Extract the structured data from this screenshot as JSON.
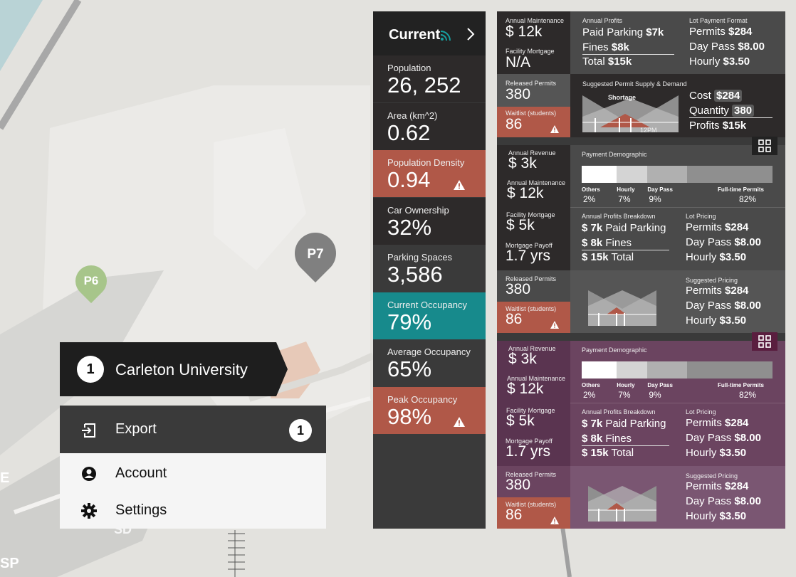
{
  "map": {
    "pins": [
      {
        "label": "P6",
        "color": "#a7c58a"
      },
      {
        "label": "P7",
        "color": "#808080"
      }
    ],
    "street_letters": [
      "E",
      "SP",
      "SD"
    ]
  },
  "campus": {
    "number": "1",
    "name": "Carleton University"
  },
  "menu": {
    "export": {
      "label": "Export",
      "badge": "1",
      "icon": "export-icon"
    },
    "account": {
      "label": "Account",
      "icon": "account-icon"
    },
    "settings": {
      "label": "Settings",
      "icon": "gear-icon"
    }
  },
  "current": {
    "title": "Current",
    "icons": [
      "rss-icon",
      "chevron-right-icon"
    ],
    "stats": [
      {
        "label": "Population",
        "value": "26, 252",
        "color": "#2d2a2a",
        "warn": false
      },
      {
        "label": "Area (km^2)",
        "value": "0.62",
        "color": "#2d2a2a",
        "warn": false
      },
      {
        "label": "Population Density",
        "value": "0.94",
        "color": "#b05848",
        "warn": true
      },
      {
        "label": "Car Ownership",
        "value": "32%",
        "color": "#2d2a2a",
        "warn": false
      },
      {
        "label": "Parking Spaces",
        "value": "3,586",
        "color": "#3a3a3a",
        "warn": false
      },
      {
        "label": "Current Occupancy",
        "value": "79%",
        "color": "#178a8c",
        "warn": false
      },
      {
        "label": "Average Occupancy",
        "value": "65%",
        "color": "#3a3a3a",
        "warn": false
      },
      {
        "label": "Peak Occupancy",
        "value": "98%",
        "color": "#b05848",
        "warn": true
      }
    ]
  },
  "block1": {
    "annual_maintenance_label": "Annual Maintenance",
    "annual_maintenance": "$ 12k",
    "facility_mortgage_label": "Facility Mortgage",
    "facility_mortgage": "N/A",
    "released_permits_label": "Released Permits",
    "released_permits": "380",
    "waitlist_label": "Waitlist (students)",
    "waitlist": "86",
    "profits_label": "Annual Profits",
    "profits": [
      {
        "name": "Paid Parking",
        "value": "$7k"
      },
      {
        "name": "Fines",
        "value": "$8k"
      },
      {
        "name": "Total",
        "value": "$15k"
      }
    ],
    "format_label": "Lot Payment Format",
    "format": [
      {
        "name": "Permits",
        "value": "$284"
      },
      {
        "name": "Day Pass",
        "value": "$8.00"
      },
      {
        "name": "Hourly",
        "value": "$3.50"
      }
    ],
    "supply_label": "Suggested Permit Supply & Demand",
    "shortage_label": "Shortage",
    "time_label": "12PM",
    "suggest": [
      {
        "name": "Cost",
        "value": "$284"
      },
      {
        "name": "Quantity",
        "value": "380"
      },
      {
        "name": "Profits",
        "value": "$15k"
      }
    ]
  },
  "blocks": [
    {
      "theme": "grey",
      "annual_revenue_label": "Annual Revenue",
      "annual_revenue": "$ 3k",
      "annual_maintenance_label": "Annual Maintenance",
      "annual_maintenance": "$ 12k",
      "facility_mortgage_label": "Facility Mortgage",
      "facility_mortgage": "$ 5k",
      "payoff_label": "Mortgage Payoff",
      "payoff": "1.7 yrs",
      "released_permits_label": "Released Permits",
      "released_permits": "380",
      "waitlist_label": "Waitlist (students)",
      "waitlist": "86",
      "demo_label": "Payment Demographic",
      "demo": [
        {
          "name": "Others",
          "pct": "2%",
          "share": 2
        },
        {
          "name": "Hourly",
          "pct": "7%",
          "share": 7
        },
        {
          "name": "Day Pass",
          "pct": "9%",
          "share": 9
        },
        {
          "name": "Full-time Permits",
          "pct": "82%",
          "share": 82
        }
      ],
      "breakdown_label": "Annual Profits Breakdown",
      "breakdown": [
        {
          "value": "$ 7k",
          "name": "Paid Parking"
        },
        {
          "value": "$ 8k",
          "name": "Fines"
        },
        {
          "value": "$ 15k",
          "name": "Total"
        }
      ],
      "pricing_label": "Lot Pricing",
      "pricing": [
        {
          "name": "Permits",
          "value": "$284"
        },
        {
          "name": "Day Pass",
          "value": "$8.00"
        },
        {
          "name": "Hourly",
          "value": "$3.50"
        }
      ],
      "suggested_label": "Suggested Pricing",
      "suggested": [
        {
          "name": "Permits",
          "value": "$284"
        },
        {
          "name": "Day Pass",
          "value": "$8.00"
        },
        {
          "name": "Hourly",
          "value": "$3.50"
        }
      ]
    },
    {
      "theme": "purple",
      "annual_revenue_label": "Annual Revenue",
      "annual_revenue": "$ 3k",
      "annual_maintenance_label": "Annual Maintenance",
      "annual_maintenance": "$ 12k",
      "facility_mortgage_label": "Facility Mortgage",
      "facility_mortgage": "$ 5k",
      "payoff_label": "Mortgage Payoff",
      "payoff": "1.7 yrs",
      "released_permits_label": "Released Permits",
      "released_permits": "380",
      "waitlist_label": "Waitlist (students)",
      "waitlist": "86",
      "demo_label": "Payment Demographic",
      "demo": [
        {
          "name": "Others",
          "pct": "2%",
          "share": 2
        },
        {
          "name": "Hourly",
          "pct": "7%",
          "share": 7
        },
        {
          "name": "Day Pass",
          "pct": "9%",
          "share": 9
        },
        {
          "name": "Full-time Permits",
          "pct": "82%",
          "share": 82
        }
      ],
      "breakdown_label": "Annual Profits Breakdown",
      "breakdown": [
        {
          "value": "$ 7k",
          "name": "Paid Parking"
        },
        {
          "value": "$ 8k",
          "name": "Fines"
        },
        {
          "value": "$ 15k",
          "name": "Total"
        }
      ],
      "pricing_label": "Lot Pricing",
      "pricing": [
        {
          "name": "Permits",
          "value": "$284"
        },
        {
          "name": "Day Pass",
          "value": "$8.00"
        },
        {
          "name": "Hourly",
          "value": "$3.50"
        }
      ],
      "suggested_label": "Suggested Pricing",
      "suggested": [
        {
          "name": "Permits",
          "value": "$284"
        },
        {
          "name": "Day Pass",
          "value": "$8.00"
        },
        {
          "name": "Hourly",
          "value": "$3.50"
        }
      ]
    }
  ],
  "colors": {
    "dark": "#2d2a2a",
    "warn_red": "#b05848",
    "teal": "#178a8c",
    "grey_panel": "#4a4a4a",
    "purple_panel": "#6b4460",
    "purple_dark": "#5a3450",
    "purple_top": "#5a1e3f"
  }
}
